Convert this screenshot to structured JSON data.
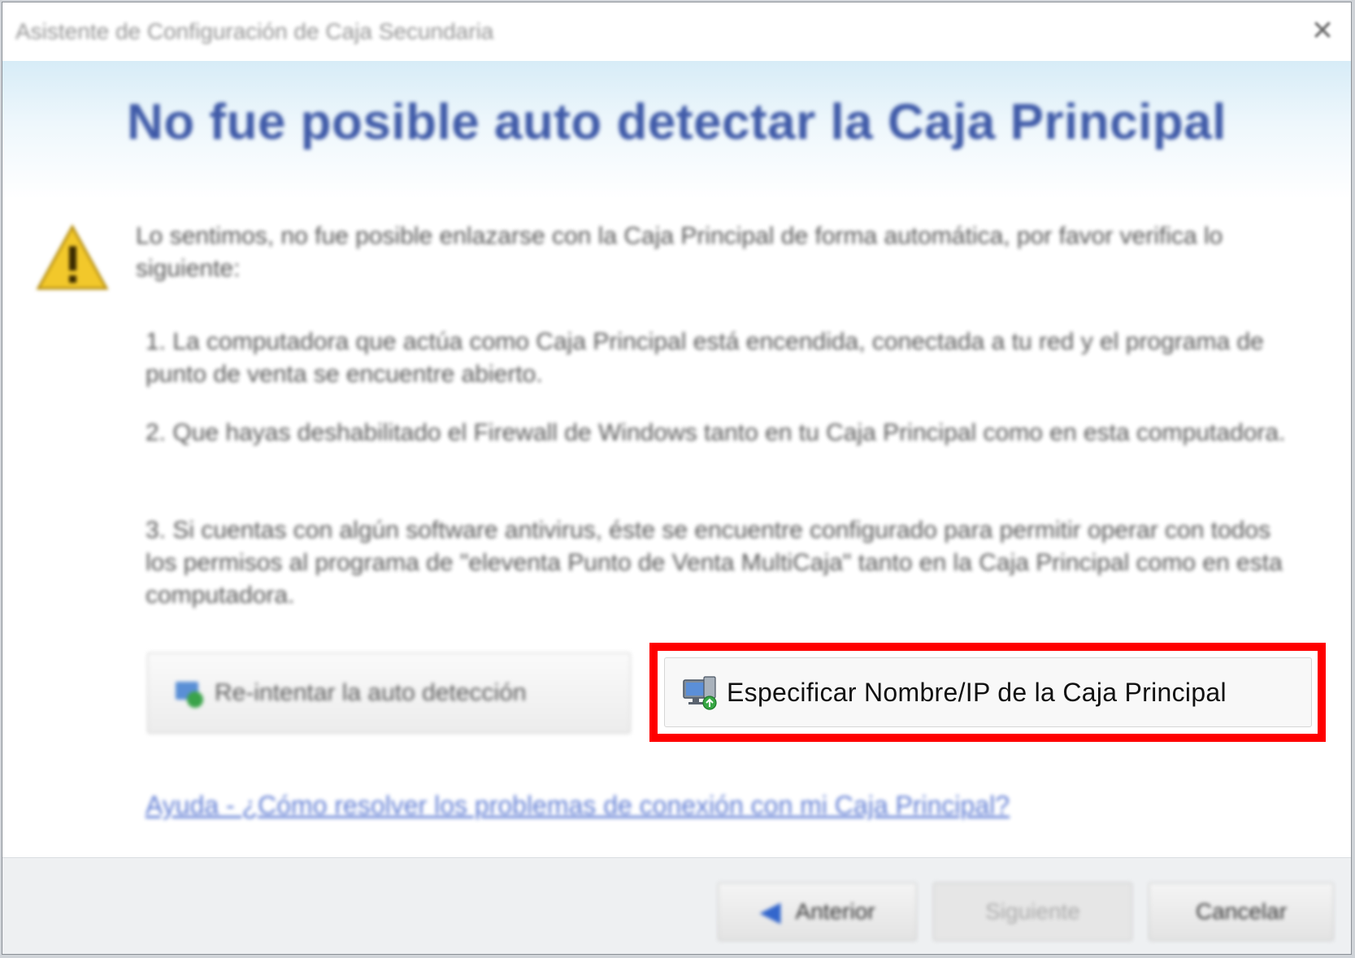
{
  "window": {
    "title": "Asistente de Configuración de Caja Secundaria",
    "close_glyph": "✕"
  },
  "banner": {
    "heading": "No fue posible auto detectar la Caja Principal"
  },
  "content": {
    "intro": "Lo sentimos, no fue posible enlazarse con la Caja Principal de forma automática, por favor verifica lo siguiente:",
    "item1": "1. La computadora que actúa como Caja Principal está encendida, conectada a tu red y el programa de punto de venta se encuentre abierto.",
    "item2": "2. Que hayas deshabilitado el Firewall de Windows tanto en tu Caja Principal como en esta computadora.",
    "item3": "3. Si cuentas con algún software antivirus, éste se encuentre configurado para permitir operar con todos los permisos al programa de \"eleventa Punto de Venta MultiCaja\" tanto en la Caja Principal como en esta computadora.",
    "warning_icon": "warning-triangle-icon"
  },
  "actions": {
    "retry_label": "Re-intentar la auto detección",
    "retry_icon": "refresh-network-icon",
    "specify_label": "Especificar Nombre/IP de la Caja Principal",
    "specify_icon": "computer-network-icon",
    "highlight_color": "#ff0000"
  },
  "help": {
    "link_text": "Ayuda - ¿Cómo resolver los problemas de conexión con mi Caja Principal?"
  },
  "footer": {
    "back_label": "Anterior",
    "back_glyph": "◀",
    "next_label": "Siguiente",
    "cancel_label": "Cancelar"
  }
}
